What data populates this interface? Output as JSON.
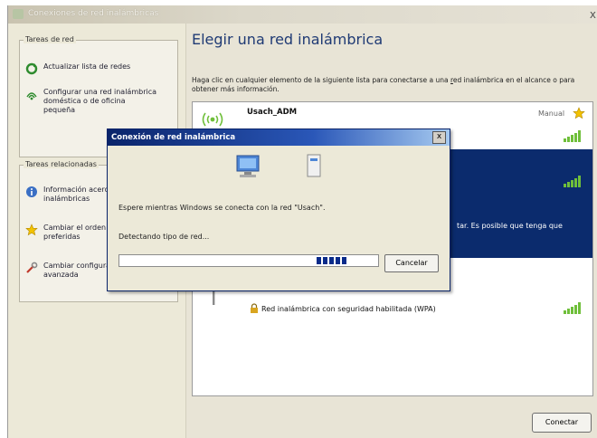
{
  "window": {
    "title": "Conexiones de red inalámbricas",
    "close": "x"
  },
  "left": {
    "tasks_heading": "Tareas de red",
    "tasks": [
      {
        "icon": "refresh-icon",
        "label": "Actualizar lista de redes"
      },
      {
        "icon": "wireless-setup-icon",
        "label": "Configurar una red inalámbrica doméstica o de oficina pequeña"
      }
    ],
    "related_heading": "Tareas relacionadas",
    "related": [
      {
        "icon": "info-icon",
        "label": "Información acerca de redes inalámbricas"
      },
      {
        "icon": "star-icon",
        "label": "Cambiar el orden de las redes preferidas"
      },
      {
        "icon": "settings-icon",
        "label": "Cambiar configuración avanzada"
      }
    ]
  },
  "main": {
    "heading": "Elegir una red inalámbrica",
    "instruction_1": "Haga clic en cualquier elemento de la siguiente lista para conectarse a una ",
    "instruction_u": "r",
    "instruction_2": "ed inalámbrica en el alcance o para obtener más información.",
    "networks": [
      {
        "ssid": "Usach_ADM",
        "mode": "Manual",
        "signal": 5
      },
      {
        "selected": true,
        "partial_text": "tar. Es posible que tenga que",
        "signal": 5
      },
      {
        "security": "Red inalámbrica con seguridad habilitada (WPA)",
        "signal": 5
      }
    ],
    "connect_label": "Conectar"
  },
  "dialog": {
    "title": "Conexión de red inalámbrica",
    "close": "x",
    "message": "Espere mientras Windows se conecta con la red \"Usach\".",
    "status": "Detectando tipo de red...",
    "progress_blocks": 5,
    "cancel_label": "Cancelar"
  },
  "colors": {
    "accent": "#0b2b6d",
    "signal": "#6fbf3a",
    "heading": "#1f3a74"
  }
}
